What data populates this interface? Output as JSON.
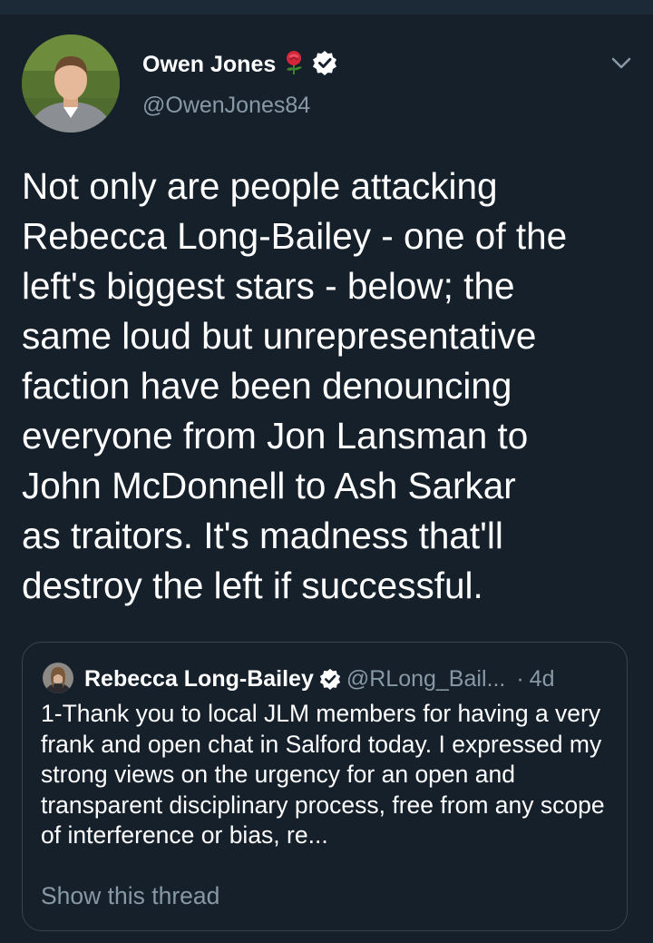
{
  "tweet": {
    "display_name": "Owen Jones",
    "rose_emoji": "🌹",
    "handle": "@OwenJones84",
    "icons": [
      "avatar",
      "rose-icon",
      "verified-icon",
      "chevron-down-icon"
    ],
    "text": "Not only are people attacking\nRebecca Long-Bailey - one of the\nleft's biggest stars - below; the\nsame loud but unrepresentative\nfaction have been denouncing\neveryone from Jon Lansman to\nJohn McDonnell to Ash Sarkar\nas traitors. It's madness that'll\ndestroy the left if successful."
  },
  "quoted_tweet": {
    "display_name": "Rebecca Long-Bailey",
    "handle": "@RLong_Bail...",
    "separator": "·",
    "time": "4d",
    "text": "1-Thank you to local JLM members for having a very frank and open chat in Salford today. I expressed my strong views on the urgency for an open and transparent disciplinary process, free from any scope of interference or bias, re...",
    "show_thread": "Show this thread"
  },
  "colors": {
    "background": "#15202b",
    "secondary_text": "#8899a6",
    "border": "#38444d",
    "primary_text": "#ffffff"
  }
}
